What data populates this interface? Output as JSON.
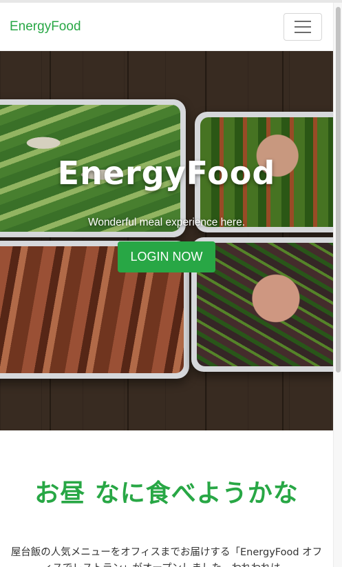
{
  "navbar": {
    "brand": "EnergyFood",
    "menu_icon": "hamburger-menu-icon"
  },
  "hero": {
    "title": "EnergyFood",
    "subtitle": "Wonderful meal experience here.",
    "login_button": "LOGIN NOW"
  },
  "intro": {
    "heading": "お昼 なに食べようかな",
    "text": "屋台飯の人気メニューをオフィスまでお届けする「EnergyFood オフィスでレストラン」がオープンしました。われわれは、"
  },
  "colors": {
    "accent": "#28a745",
    "text": "#333333"
  }
}
